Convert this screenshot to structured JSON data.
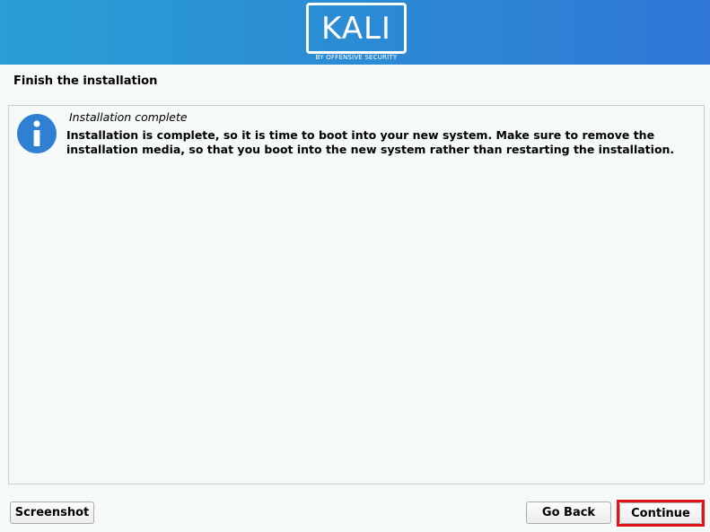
{
  "header": {
    "logo_text": "KALI",
    "logo_subtitle": "BY OFFENSIVE SECURITY",
    "brand_color": "#2b8bd4"
  },
  "page": {
    "title": "Finish the installation"
  },
  "message": {
    "icon": "info-icon",
    "heading": "Installation complete",
    "body": "Installation is complete, so it is time to boot into your new system. Make sure to remove the installation media, so that you boot into the new system rather than restarting the installation."
  },
  "buttons": {
    "screenshot": "Screenshot",
    "go_back": "Go Back",
    "continue": "Continue"
  },
  "colors": {
    "info_icon": "#2f7fd3",
    "highlight": "#e0151b"
  }
}
